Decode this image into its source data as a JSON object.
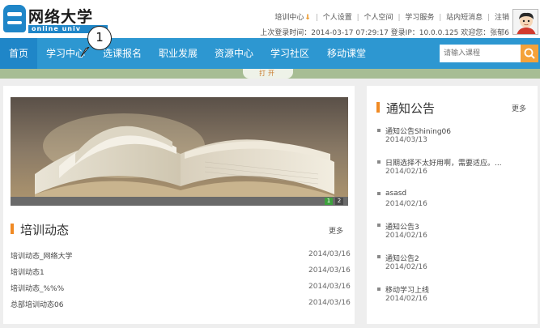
{
  "header": {
    "logo_title": "网络大学",
    "logo_sub": "online univ",
    "links": [
      "培训中心",
      "个人设置",
      "个人空间",
      "学习服务",
      "站内短消息",
      "注销"
    ],
    "login_info": "上次登录时间：2014-03-17 07:29:17 登录IP：10.0.0.125 欢迎您：张郁6"
  },
  "nav": {
    "items": [
      "首页",
      "学习中心",
      "选课报名",
      "职业发展",
      "资源中心",
      "学习社区",
      "移动课堂"
    ],
    "search_placeholder": "请输入课程"
  },
  "open_tab": "打开",
  "callout_number": "1",
  "banner": {
    "slides": [
      "1",
      "2"
    ],
    "active_slide": "1"
  },
  "training": {
    "title": "培训动态",
    "more": "更多",
    "rows": [
      {
        "title": "培训动态_网络大学",
        "date": "2014/03/16"
      },
      {
        "title": "培训动态1",
        "date": "2014/03/16"
      },
      {
        "title": "培训动态_%%%",
        "date": "2014/03/16"
      },
      {
        "title": "总部培训动态06",
        "date": "2014/03/16"
      }
    ]
  },
  "notices": {
    "title": "通知公告",
    "more": "更多",
    "items": [
      {
        "title": "通知公告Shining06",
        "date": "2014/03/13"
      },
      {
        "title": "日期选择不太好用啊，需要适应。...",
        "date": "2014/02/16"
      },
      {
        "title": "asasd",
        "date": "2014/02/16"
      },
      {
        "title": "通知公告3",
        "date": "2014/02/16"
      },
      {
        "title": "通知公告2",
        "date": "2014/02/16"
      },
      {
        "title": "移动学习上线",
        "date": "2014/02/16"
      }
    ]
  },
  "colors": {
    "nav_blue": "#2d97d1",
    "nav_home": "#1f86c8",
    "accent_orange": "#f08a24",
    "green_bar": "#a7bd94"
  }
}
